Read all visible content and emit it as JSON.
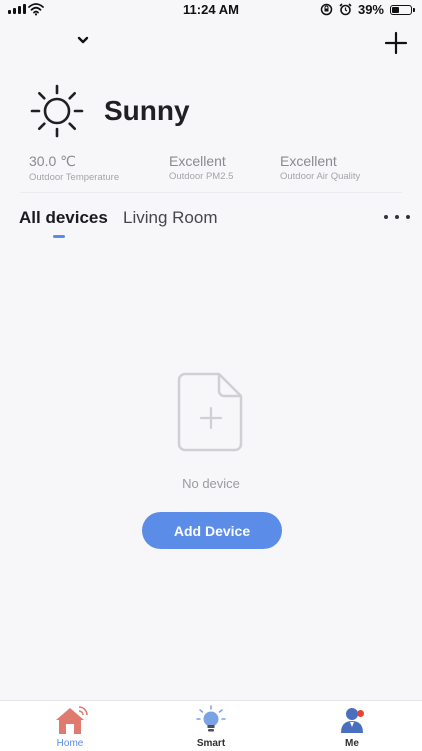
{
  "status_bar": {
    "time": "11:24 AM",
    "battery": "39%",
    "battery_level": 0.39
  },
  "header": {
    "home_name": "",
    "add_icon": "plus-icon",
    "dropdown_icon": "chevron-down-icon"
  },
  "weather": {
    "condition": "Sunny",
    "icon": "sun-icon",
    "metrics": [
      {
        "value": "30.0 ℃",
        "label": "Outdoor Temperature"
      },
      {
        "value": "Excellent",
        "label": "Outdoor PM2.5"
      },
      {
        "value": "Excellent",
        "label": "Outdoor Air Quality"
      }
    ]
  },
  "tabs": [
    {
      "label": "All devices",
      "active": true
    },
    {
      "label": "Living Room",
      "active": false
    }
  ],
  "empty_state": {
    "message": "No device",
    "button_label": "Add Device"
  },
  "bottom_nav": [
    {
      "label": "Home",
      "icon": "home-icon",
      "active": true
    },
    {
      "label": "Smart",
      "icon": "lightbulb-icon",
      "active": false
    },
    {
      "label": "Me",
      "icon": "user-icon",
      "active": false,
      "badge": true
    }
  ],
  "colors": {
    "accent": "#5b8de8",
    "background": "#f7f7f9",
    "home_icon": "#e07a6e",
    "badge": "#e8432e"
  }
}
